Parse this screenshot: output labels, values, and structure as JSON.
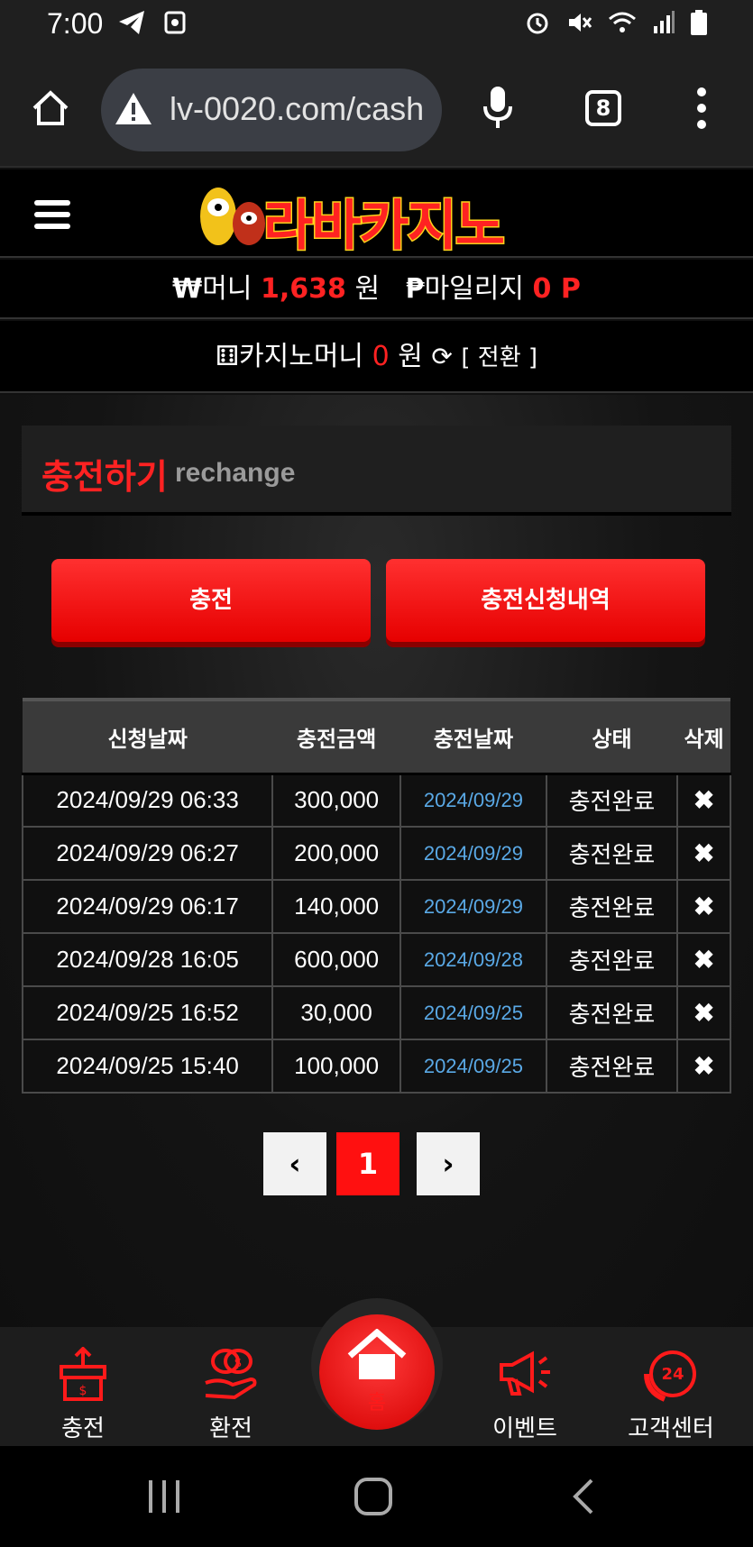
{
  "status_bar": {
    "time": "7:00"
  },
  "browser": {
    "url": "lv-0020.com/cash",
    "tab_count": "8"
  },
  "site": {
    "logo_text": "라바카지노",
    "money_label": "머니",
    "money_value": "1,638",
    "money_unit": "원",
    "mileage_label": "마일리지",
    "mileage_value": "0 P",
    "casino_money_label": "카지노머니",
    "casino_money_value": "0",
    "casino_money_unit": "원",
    "convert_label": "[ 전환 ]"
  },
  "section": {
    "title_ko": "충전하기",
    "title_en": "rechange"
  },
  "buttons": {
    "charge": "충전",
    "history": "충전신청내역"
  },
  "table": {
    "headers": [
      "신청날짜",
      "충전금액",
      "충전날짜",
      "상태",
      "삭제"
    ],
    "rows": [
      {
        "requested": "2024/09/29 06:33",
        "amount": "300,000",
        "charged": "2024/09/29",
        "status": "충전완료"
      },
      {
        "requested": "2024/09/29 06:27",
        "amount": "200,000",
        "charged": "2024/09/29",
        "status": "충전완료"
      },
      {
        "requested": "2024/09/29 06:17",
        "amount": "140,000",
        "charged": "2024/09/29",
        "status": "충전완료"
      },
      {
        "requested": "2024/09/28 16:05",
        "amount": "600,000",
        "charged": "2024/09/28",
        "status": "충전완료"
      },
      {
        "requested": "2024/09/25 16:52",
        "amount": "30,000",
        "charged": "2024/09/25",
        "status": "충전완료"
      },
      {
        "requested": "2024/09/25 15:40",
        "amount": "100,000",
        "charged": "2024/09/25",
        "status": "충전완료"
      }
    ],
    "delete_glyph": "✖"
  },
  "pagination": {
    "prev": "‹",
    "current": "1",
    "next": "›"
  },
  "bottom_nav": {
    "charge": "충전",
    "exchange": "환전",
    "home": "홈",
    "event": "이벤트",
    "support": "고객센터"
  },
  "colors": {
    "accent": "#ff2222",
    "date_blue": "#5aa9e6"
  }
}
